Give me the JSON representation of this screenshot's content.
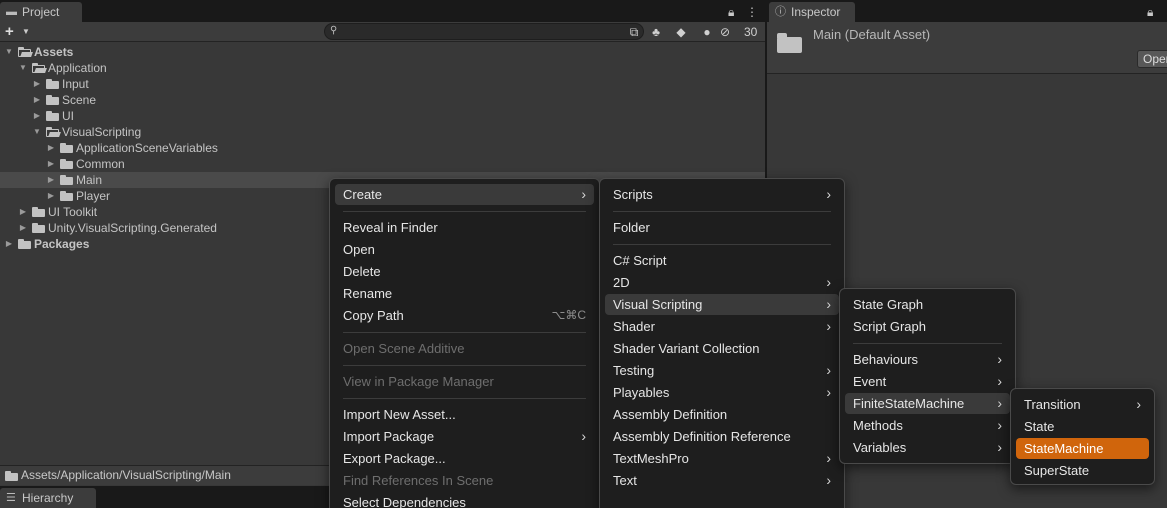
{
  "project": {
    "tab_label": "Project",
    "tab_icon": "folder-icon",
    "search": {
      "value": "",
      "placeholder": ""
    },
    "hidden_count": "30",
    "tree": [
      {
        "label": "Assets",
        "depth": 0,
        "open": true,
        "bold": true
      },
      {
        "label": "Application",
        "depth": 1,
        "open": true
      },
      {
        "label": "Input",
        "depth": 2,
        "open": false
      },
      {
        "label": "Scene",
        "depth": 2,
        "open": false
      },
      {
        "label": "UI",
        "depth": 2,
        "open": false
      },
      {
        "label": "VisualScripting",
        "depth": 2,
        "open": true
      },
      {
        "label": "ApplicationSceneVariables",
        "depth": 3,
        "open": false
      },
      {
        "label": "Common",
        "depth": 3,
        "open": false
      },
      {
        "label": "Main",
        "depth": 3,
        "open": false,
        "selected": true
      },
      {
        "label": "Player",
        "depth": 3,
        "open": false
      },
      {
        "label": "UI Toolkit",
        "depth": 1,
        "open": false
      },
      {
        "label": "Unity.VisualScripting.Generated",
        "depth": 1,
        "open": false
      },
      {
        "label": "Packages",
        "depth": 0,
        "open": false,
        "bold": true
      }
    ],
    "path": "Assets/Application/VisualScripting/Main"
  },
  "hierarchy": {
    "tab_label": "Hierarchy"
  },
  "inspector": {
    "tab_label": "Inspector",
    "title": "Main (Default Asset)",
    "open_button": "Open"
  },
  "context_menu": {
    "items": [
      {
        "label": "Create",
        "submenu": true,
        "highlighted": true
      },
      {
        "sep": true
      },
      {
        "label": "Reveal in Finder"
      },
      {
        "label": "Open"
      },
      {
        "label": "Delete"
      },
      {
        "label": "Rename"
      },
      {
        "label": "Copy Path",
        "shortcut": "⌥⌘C"
      },
      {
        "sep": true
      },
      {
        "label": "Open Scene Additive",
        "disabled": true
      },
      {
        "sep": true
      },
      {
        "label": "View in Package Manager",
        "disabled": true
      },
      {
        "sep": true
      },
      {
        "label": "Import New Asset..."
      },
      {
        "label": "Import Package",
        "submenu": true
      },
      {
        "label": "Export Package..."
      },
      {
        "label": "Find References In Scene",
        "disabled": true
      },
      {
        "label": "Select Dependencies"
      }
    ]
  },
  "create_menu": {
    "items": [
      {
        "label": "Scripts",
        "submenu": true
      },
      {
        "sep": true
      },
      {
        "label": "Folder"
      },
      {
        "sep": true
      },
      {
        "label": "C# Script"
      },
      {
        "label": "2D",
        "submenu": true
      },
      {
        "label": "Visual Scripting",
        "submenu": true,
        "highlighted": true
      },
      {
        "label": "Shader",
        "submenu": true
      },
      {
        "label": "Shader Variant Collection"
      },
      {
        "label": "Testing",
        "submenu": true
      },
      {
        "label": "Playables",
        "submenu": true
      },
      {
        "label": "Assembly Definition"
      },
      {
        "label": "Assembly Definition Reference"
      },
      {
        "label": "TextMeshPro",
        "submenu": true
      },
      {
        "label": "Text",
        "submenu": true
      }
    ]
  },
  "visual_scripting_menu": {
    "items": [
      {
        "label": "State Graph"
      },
      {
        "label": "Script Graph"
      },
      {
        "sep": true
      },
      {
        "label": "Behaviours",
        "submenu": true
      },
      {
        "label": "Event",
        "submenu": true
      },
      {
        "label": "FiniteStateMachine",
        "submenu": true,
        "highlighted": true
      },
      {
        "label": "Methods",
        "submenu": true
      },
      {
        "label": "Variables",
        "submenu": true
      }
    ]
  },
  "fsm_menu": {
    "items": [
      {
        "label": "Transition",
        "submenu": true
      },
      {
        "label": "State"
      },
      {
        "label": "StateMachine",
        "active": true
      },
      {
        "label": "SuperState"
      }
    ]
  },
  "colors": {
    "accent": "#d0650c",
    "panel": "#383838",
    "menu_bg": "#1e1e1e",
    "selected_row": "#4a4a4a"
  }
}
